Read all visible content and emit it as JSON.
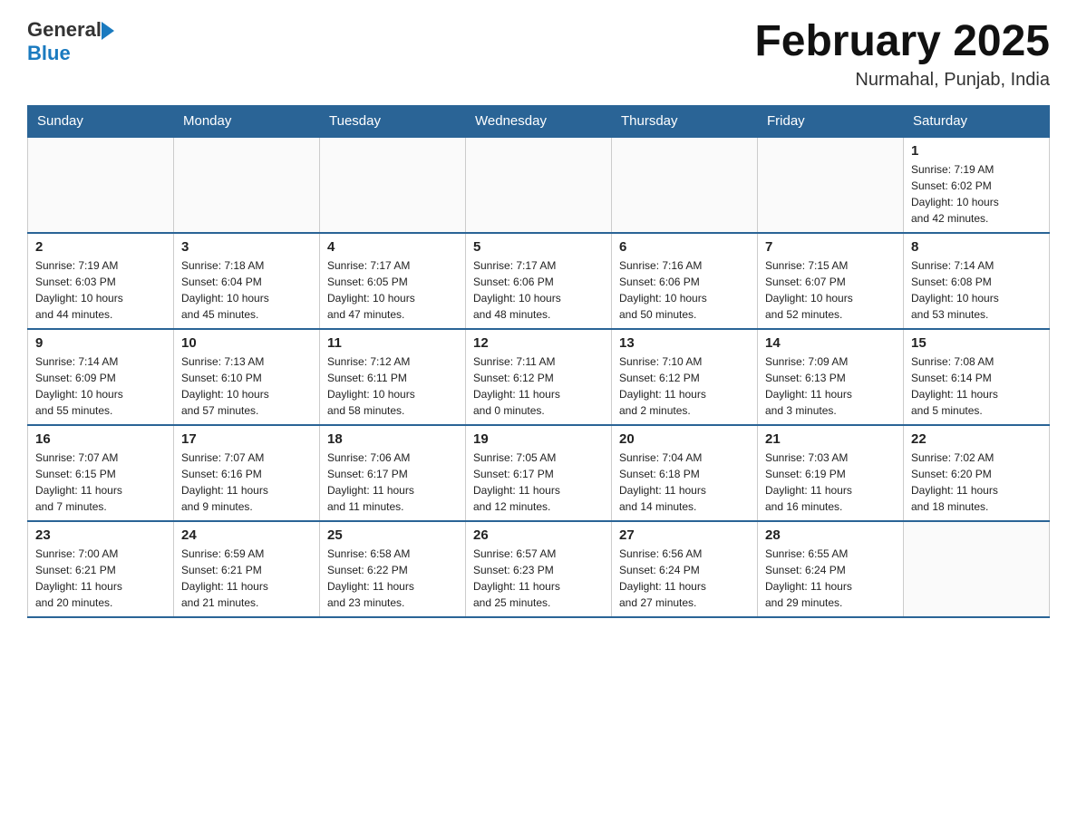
{
  "header": {
    "logo_general": "General",
    "logo_blue": "Blue",
    "month": "February 2025",
    "location": "Nurmahal, Punjab, India"
  },
  "weekdays": [
    "Sunday",
    "Monday",
    "Tuesday",
    "Wednesday",
    "Thursday",
    "Friday",
    "Saturday"
  ],
  "weeks": [
    [
      {
        "day": "",
        "info": ""
      },
      {
        "day": "",
        "info": ""
      },
      {
        "day": "",
        "info": ""
      },
      {
        "day": "",
        "info": ""
      },
      {
        "day": "",
        "info": ""
      },
      {
        "day": "",
        "info": ""
      },
      {
        "day": "1",
        "info": "Sunrise: 7:19 AM\nSunset: 6:02 PM\nDaylight: 10 hours\nand 42 minutes."
      }
    ],
    [
      {
        "day": "2",
        "info": "Sunrise: 7:19 AM\nSunset: 6:03 PM\nDaylight: 10 hours\nand 44 minutes."
      },
      {
        "day": "3",
        "info": "Sunrise: 7:18 AM\nSunset: 6:04 PM\nDaylight: 10 hours\nand 45 minutes."
      },
      {
        "day": "4",
        "info": "Sunrise: 7:17 AM\nSunset: 6:05 PM\nDaylight: 10 hours\nand 47 minutes."
      },
      {
        "day": "5",
        "info": "Sunrise: 7:17 AM\nSunset: 6:06 PM\nDaylight: 10 hours\nand 48 minutes."
      },
      {
        "day": "6",
        "info": "Sunrise: 7:16 AM\nSunset: 6:06 PM\nDaylight: 10 hours\nand 50 minutes."
      },
      {
        "day": "7",
        "info": "Sunrise: 7:15 AM\nSunset: 6:07 PM\nDaylight: 10 hours\nand 52 minutes."
      },
      {
        "day": "8",
        "info": "Sunrise: 7:14 AM\nSunset: 6:08 PM\nDaylight: 10 hours\nand 53 minutes."
      }
    ],
    [
      {
        "day": "9",
        "info": "Sunrise: 7:14 AM\nSunset: 6:09 PM\nDaylight: 10 hours\nand 55 minutes."
      },
      {
        "day": "10",
        "info": "Sunrise: 7:13 AM\nSunset: 6:10 PM\nDaylight: 10 hours\nand 57 minutes."
      },
      {
        "day": "11",
        "info": "Sunrise: 7:12 AM\nSunset: 6:11 PM\nDaylight: 10 hours\nand 58 minutes."
      },
      {
        "day": "12",
        "info": "Sunrise: 7:11 AM\nSunset: 6:12 PM\nDaylight: 11 hours\nand 0 minutes."
      },
      {
        "day": "13",
        "info": "Sunrise: 7:10 AM\nSunset: 6:12 PM\nDaylight: 11 hours\nand 2 minutes."
      },
      {
        "day": "14",
        "info": "Sunrise: 7:09 AM\nSunset: 6:13 PM\nDaylight: 11 hours\nand 3 minutes."
      },
      {
        "day": "15",
        "info": "Sunrise: 7:08 AM\nSunset: 6:14 PM\nDaylight: 11 hours\nand 5 minutes."
      }
    ],
    [
      {
        "day": "16",
        "info": "Sunrise: 7:07 AM\nSunset: 6:15 PM\nDaylight: 11 hours\nand 7 minutes."
      },
      {
        "day": "17",
        "info": "Sunrise: 7:07 AM\nSunset: 6:16 PM\nDaylight: 11 hours\nand 9 minutes."
      },
      {
        "day": "18",
        "info": "Sunrise: 7:06 AM\nSunset: 6:17 PM\nDaylight: 11 hours\nand 11 minutes."
      },
      {
        "day": "19",
        "info": "Sunrise: 7:05 AM\nSunset: 6:17 PM\nDaylight: 11 hours\nand 12 minutes."
      },
      {
        "day": "20",
        "info": "Sunrise: 7:04 AM\nSunset: 6:18 PM\nDaylight: 11 hours\nand 14 minutes."
      },
      {
        "day": "21",
        "info": "Sunrise: 7:03 AM\nSunset: 6:19 PM\nDaylight: 11 hours\nand 16 minutes."
      },
      {
        "day": "22",
        "info": "Sunrise: 7:02 AM\nSunset: 6:20 PM\nDaylight: 11 hours\nand 18 minutes."
      }
    ],
    [
      {
        "day": "23",
        "info": "Sunrise: 7:00 AM\nSunset: 6:21 PM\nDaylight: 11 hours\nand 20 minutes."
      },
      {
        "day": "24",
        "info": "Sunrise: 6:59 AM\nSunset: 6:21 PM\nDaylight: 11 hours\nand 21 minutes."
      },
      {
        "day": "25",
        "info": "Sunrise: 6:58 AM\nSunset: 6:22 PM\nDaylight: 11 hours\nand 23 minutes."
      },
      {
        "day": "26",
        "info": "Sunrise: 6:57 AM\nSunset: 6:23 PM\nDaylight: 11 hours\nand 25 minutes."
      },
      {
        "day": "27",
        "info": "Sunrise: 6:56 AM\nSunset: 6:24 PM\nDaylight: 11 hours\nand 27 minutes."
      },
      {
        "day": "28",
        "info": "Sunrise: 6:55 AM\nSunset: 6:24 PM\nDaylight: 11 hours\nand 29 minutes."
      },
      {
        "day": "",
        "info": ""
      }
    ]
  ]
}
